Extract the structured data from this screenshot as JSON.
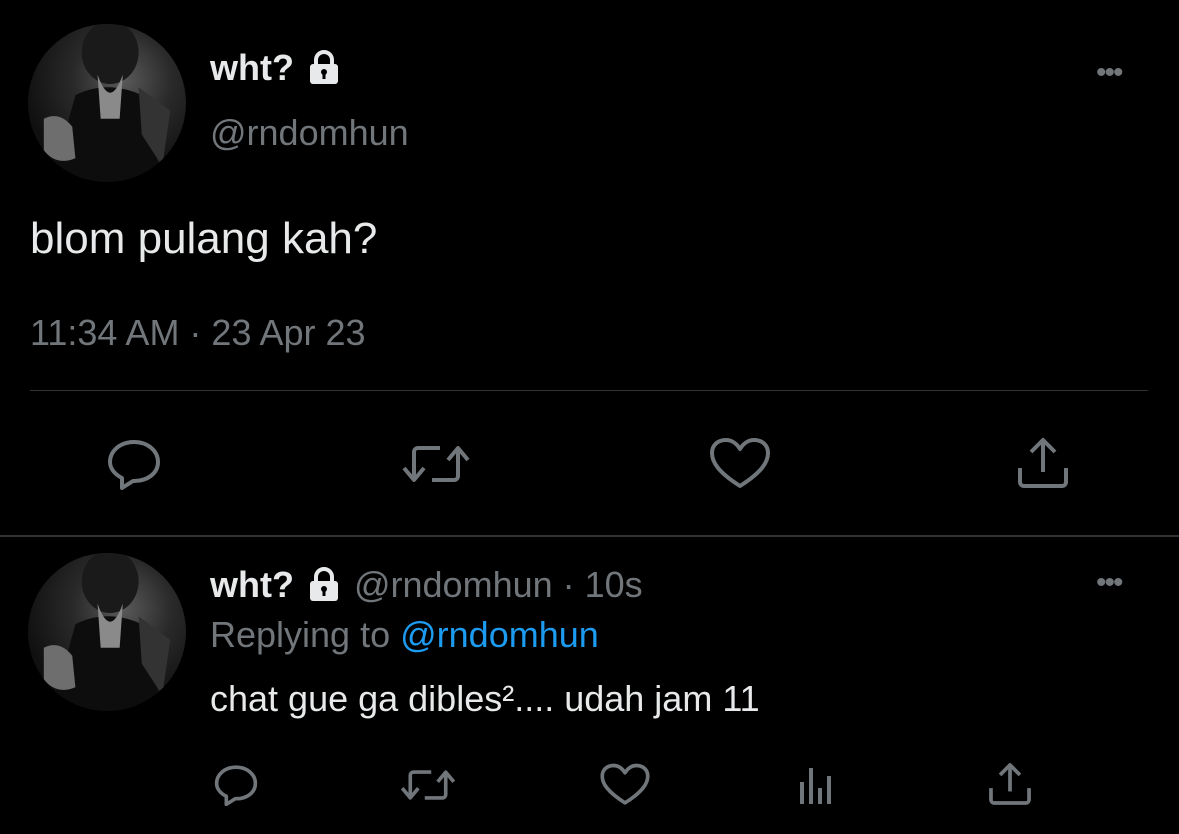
{
  "main_tweet": {
    "display_name": "wht?",
    "handle": "@rndomhun",
    "text": "blom pulang kah?",
    "timestamp": "11:34 AM · 23 Apr 23",
    "more_label": "•••"
  },
  "reply_tweet": {
    "display_name": "wht?",
    "handle_time": "@rndomhun · 10s",
    "replying_prefix": "Replying to",
    "replying_to": "@rndomhun",
    "text": "chat gue ga dibles².... udah jam 11",
    "more_label": "•••"
  },
  "icons": {
    "lock": "lock-icon",
    "reply": "reply-icon",
    "retweet": "retweet-icon",
    "like": "heart-icon",
    "share": "share-icon",
    "views": "views-icon",
    "more": "more-icon"
  },
  "colors": {
    "background": "#000000",
    "text": "#e7e9ea",
    "secondary": "#71767b",
    "accent": "#1d9bf0",
    "divider": "#2f3336"
  }
}
